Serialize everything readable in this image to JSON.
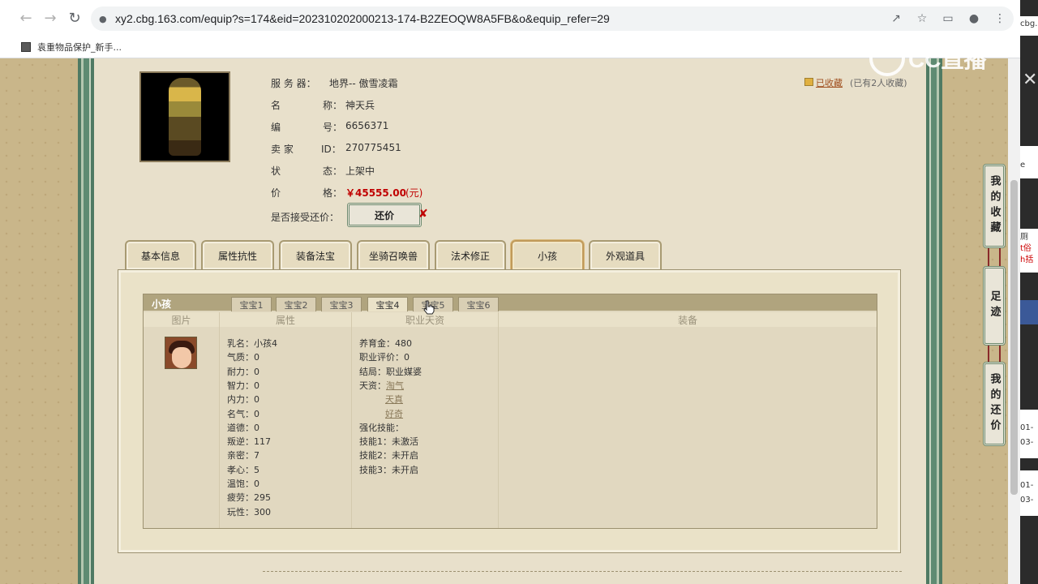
{
  "browser": {
    "url": "xy2.cbg.163.com/equip?s=174&eid=202310202000213-174-B2ZEOQW8A5FB&o&equip_refer=29",
    "bookmark": "袁重物品保护_新手..."
  },
  "watermark": "CC直播",
  "side_fragments": [
    "cbg.",
    "e",
    "厕",
    "t俗",
    "h括",
    "01-",
    "03-",
    "01-",
    "03-"
  ],
  "header": {
    "server_label": "服 务 器：",
    "server_value": "地界-- 傲雪凌霜",
    "name_label_a": "名",
    "name_label_b": "称：",
    "name_value": "神天兵",
    "id_label_a": "编",
    "id_label_b": "号：",
    "id_value": "6656371",
    "seller_label_a": "卖 家",
    "seller_label_b": "ID：",
    "seller_value": "270775451",
    "status_label_a": "状",
    "status_label_b": "态：",
    "status_value": "上架中",
    "price_label_a": "价",
    "price_label_b": "格：",
    "price_value": "￥45555.00",
    "price_unit": "(元)",
    "bargain_label": "是否接受还价：",
    "bargain_button": "还价",
    "bargain_x": "✘",
    "favorite_link": "已收藏",
    "favorite_note": "(已有2人收藏)"
  },
  "tabs": [
    "基本信息",
    "属性抗性",
    "装备法宝",
    "坐骑召唤兽",
    "法术修正",
    "小孩",
    "外观道具"
  ],
  "active_tab": "小孩",
  "panel": {
    "title": "小孩",
    "subtabs": [
      "宝宝1",
      "宝宝2",
      "宝宝3",
      "宝宝4",
      "宝宝5",
      "宝宝6"
    ],
    "active_subtab": "宝宝4",
    "columns": [
      "图片",
      "属性",
      "职业天资",
      "装备"
    ],
    "attrs": [
      {
        "k": "乳名：",
        "v": "小孩4"
      },
      {
        "k": "气质：",
        "v": "0"
      },
      {
        "k": "耐力：",
        "v": "0"
      },
      {
        "k": "智力：",
        "v": "0"
      },
      {
        "k": "内力：",
        "v": "0"
      },
      {
        "k": "名气：",
        "v": "0"
      },
      {
        "k": "道德：",
        "v": "0"
      },
      {
        "k": "叛逆：",
        "v": "117"
      },
      {
        "k": "亲密：",
        "v": "7"
      },
      {
        "k": "孝心：",
        "v": "5"
      },
      {
        "k": "温饱：",
        "v": "0"
      },
      {
        "k": "疲劳：",
        "v": "295"
      },
      {
        "k": "玩性：",
        "v": "300"
      }
    ],
    "career": [
      {
        "k": "养育金：",
        "v": "480"
      },
      {
        "k": "职业评价：",
        "v": "0"
      },
      {
        "k": "结局：",
        "v": "职业媒婆"
      },
      {
        "k": "天资：",
        "v": "淘气"
      }
    ],
    "talents_extra": [
      "天真",
      "好奇"
    ],
    "skills_label": "强化技能：",
    "skills": [
      {
        "k": "技能1：",
        "v": "未激活"
      },
      {
        "k": "技能2：",
        "v": "未开启"
      },
      {
        "k": "技能3：",
        "v": "未开启"
      }
    ]
  },
  "float_buttons": [
    "我的收藏",
    "足迹",
    "我的还价"
  ]
}
